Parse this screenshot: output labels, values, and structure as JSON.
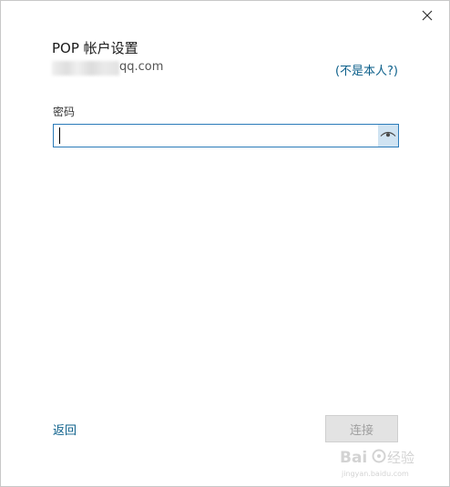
{
  "dialog": {
    "title": "POP 帐户设置",
    "email_suffix": "qq.com",
    "not_me_link": "(不是本人?)",
    "password_label": "密码",
    "password_value": "",
    "back_link": "返回",
    "connect_button": "连接"
  },
  "icons": {
    "close": "close-icon",
    "reveal_password": "eye-icon"
  },
  "watermark": {
    "text": "Baidu 经验",
    "url": "jingyan.baidu.com"
  },
  "colors": {
    "accent": "#2b7bb9",
    "link": "#0b5f8a",
    "reveal_bg": "#cfe3f2",
    "disabled_button_bg": "#e3e3e3",
    "disabled_button_text": "#a0a0a0"
  }
}
